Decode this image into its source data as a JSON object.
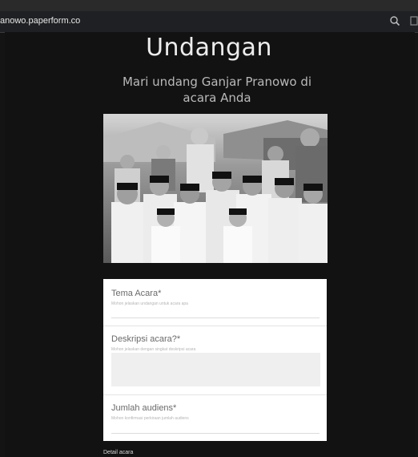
{
  "browser": {
    "url": "anowo.paperform.co",
    "zoom_icon": "magnifier-icon",
    "cut_icon": "page-icon"
  },
  "page": {
    "title": "Undangan",
    "subtitle": "Mari undang Ganjar Pranowo di acara Anda"
  },
  "photo": {
    "subject": "photo-icon",
    "palette": "grayscale"
  },
  "form": {
    "fields": [
      {
        "label": "Tema Acara*",
        "help": "Mohon jelaskan undangan untuk acara apa"
      },
      {
        "label": "Deskripsi acara?*",
        "help": "Mohon jelaskan dengan singkat deskripsi acara"
      },
      {
        "label": "Jumlah audiens*",
        "help": "Mohon konfirmasi perkiraan jumlah audiens"
      }
    ]
  },
  "footer": {
    "label": "Detail acara"
  }
}
